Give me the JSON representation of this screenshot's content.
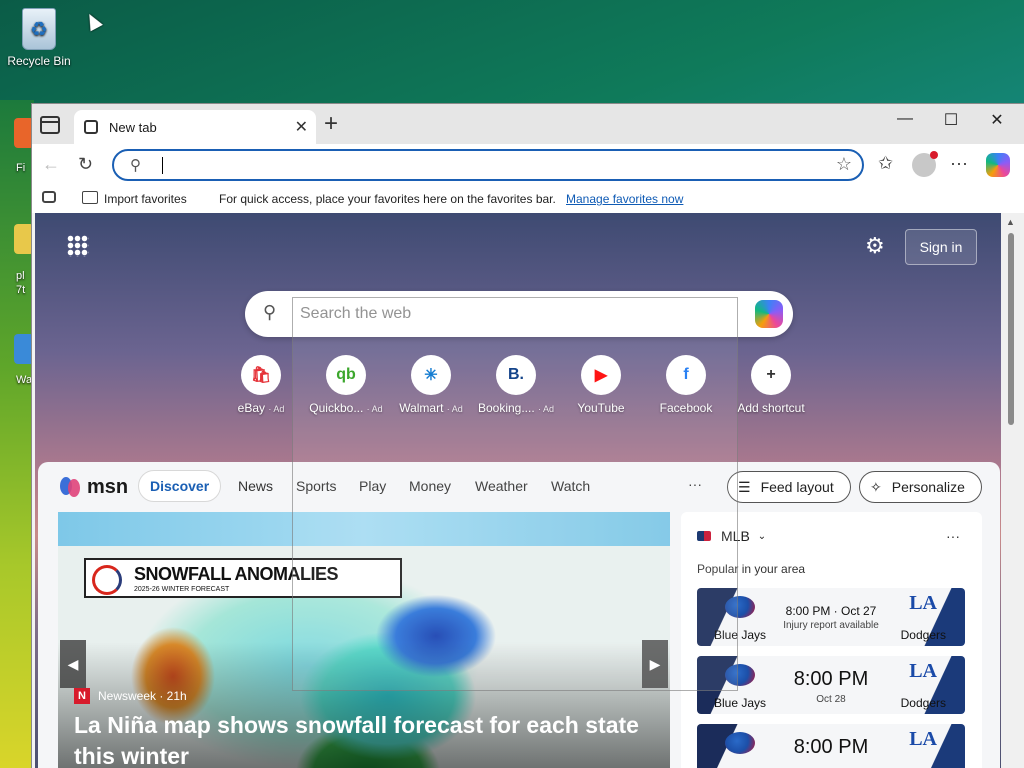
{
  "desktop": {
    "recycle_bin_label": "Recycle Bin",
    "side_labels": [
      "Fi",
      "pl",
      "7t",
      "Wa"
    ]
  },
  "browser": {
    "tab_title": "New tab",
    "favorites_bar": {
      "import_label": "Import favorites",
      "message": "For quick access, place your favorites here on the favorites bar.",
      "link": "Manage favorites now"
    }
  },
  "newtab": {
    "signin_label": "Sign in",
    "search_placeholder": "Search the web",
    "shortcuts": [
      {
        "label": "eBay",
        "ad": "· Ad",
        "icon": "ebay-icon",
        "glyph": "🛍",
        "color": "#e53238"
      },
      {
        "label": "Quickbo...",
        "ad": "· Ad",
        "icon": "quickbooks-icon",
        "glyph": "qb",
        "color": "#2ca01c"
      },
      {
        "label": "Walmart",
        "ad": "· Ad",
        "icon": "walmart-icon",
        "glyph": "✳",
        "color": "#0071ce"
      },
      {
        "label": "Booking....",
        "ad": "· Ad",
        "icon": "booking-icon",
        "glyph": "B.",
        "color": "#003580"
      },
      {
        "label": "YouTube",
        "ad": "",
        "icon": "youtube-icon",
        "glyph": "▶",
        "color": "#ff0000"
      },
      {
        "label": "Facebook",
        "ad": "",
        "icon": "facebook-icon",
        "glyph": "f",
        "color": "#1877f2"
      },
      {
        "label": "Add shortcut",
        "ad": "",
        "icon": "plus-icon",
        "glyph": "+",
        "color": "#333333"
      }
    ]
  },
  "feed": {
    "logo_text": "msn",
    "tabs": [
      "Discover",
      "News",
      "Sports",
      "Play",
      "Money",
      "Weather",
      "Watch"
    ],
    "more": "···",
    "feed_layout_label": "Feed layout",
    "personalize_label": "Personalize",
    "hero": {
      "banner_title": "SNOWFALL ANOMALIES",
      "banner_sub": "2025-26 WINTER FORECAST",
      "source": "Newsweek · 21h",
      "source_letter": "N",
      "headline": "La Niña map shows snowfall forecast for each state this winter"
    },
    "mlb": {
      "league": "MLB",
      "subtitle": "Popular in your area",
      "games": [
        {
          "home": "Blue Jays",
          "away": "Dodgers",
          "time": "8:00 PM · Oct 27",
          "note": "Injury report available",
          "style": "small"
        },
        {
          "home": "Blue Jays",
          "away": "Dodgers",
          "time": "8:00 PM",
          "note": "Oct 28",
          "style": "large"
        },
        {
          "home": "",
          "away": "",
          "time": "8:00 PM",
          "note": "",
          "style": "large"
        }
      ]
    }
  },
  "colors": {
    "accent": "#1a5fb4",
    "link": "#0f5bb5"
  }
}
